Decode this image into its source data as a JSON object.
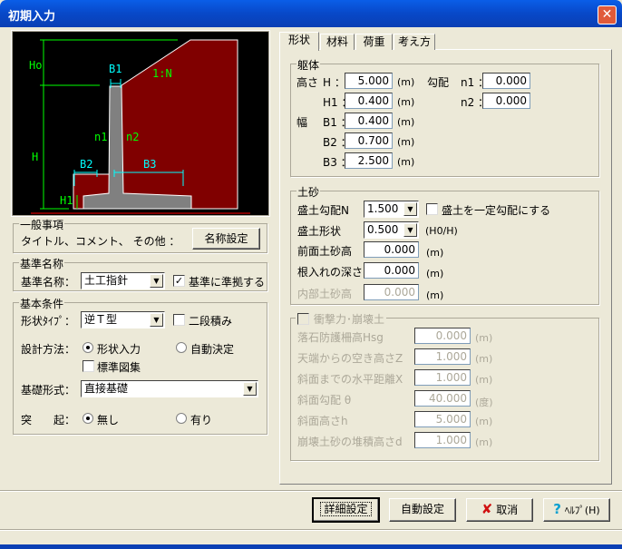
{
  "window": {
    "title": "初期入力",
    "close": "✕"
  },
  "diagram": {
    "labels": {
      "ho": "Ho",
      "h": "H",
      "h1": "H1",
      "b1": "B1",
      "b2": "B2",
      "b3": "B3",
      "n1": "n1",
      "n2": "n2",
      "slope": "1:N"
    }
  },
  "general": {
    "title": "一般事項",
    "text": "タイトル、コメント、 その他 ：",
    "button": "名称設定"
  },
  "standard": {
    "title": "基準名称",
    "label": "基準名称：",
    "value": "土工指針",
    "checkbox_label": "基準に準拠する",
    "checked": true
  },
  "basic": {
    "title": "基本条件",
    "shape_label": "形状ﾀｲﾌﾟ：",
    "shape_value": "逆Ｔ型",
    "two_stage": "二段積み",
    "design_label": "設計方法：",
    "design_opt1": "形状入力",
    "design_opt2": "自動決定",
    "std_drawings": "標準図集",
    "found_label": "基礎形式：",
    "found_value": "直接基礎",
    "proj_label": "突　　起：",
    "proj_opt1": "無し",
    "proj_opt2": "有り"
  },
  "tabs": [
    "形状",
    "材料",
    "荷重",
    "考え方"
  ],
  "body": {
    "title": "躯体",
    "height_label": "高さ",
    "width_label": "幅",
    "slope_label": "勾配",
    "unit": "(m)",
    "H": {
      "label": "H ：",
      "value": "5.000"
    },
    "H1": {
      "label": "H1 ：",
      "value": "0.400"
    },
    "B1": {
      "label": "B1 ：",
      "value": "0.400"
    },
    "B2": {
      "label": "B2 ：",
      "value": "0.700"
    },
    "B3": {
      "label": "B3 ：",
      "value": "2.500"
    },
    "n1": {
      "label": "n1 ：",
      "value": "0.000"
    },
    "n2": {
      "label": "n2 ：",
      "value": "0.000"
    }
  },
  "soil": {
    "title": "土砂",
    "fill_slope_label": "盛土勾配N",
    "fill_slope_value": "1.500",
    "const_slope": "盛土を一定勾配にする",
    "fill_shape_label": "盛土形状",
    "fill_shape_value": "0.500",
    "fill_shape_unit": "(H0/H)",
    "front_label": "前面土砂高",
    "front_value": "0.000",
    "embed_label": "根入れの深さ",
    "embed_value": "0.000",
    "inner_label": "内部土砂高",
    "inner_value": "0.000",
    "unit": "(m)"
  },
  "impact": {
    "title": "衝撃力･崩壊土",
    "rows": [
      {
        "label": "落石防護柵高Hsg",
        "value": "0.000",
        "unit": "(m)"
      },
      {
        "label": "天端からの空き高さZ",
        "value": "1.000",
        "unit": "(m)"
      },
      {
        "label": "斜面までの水平距離X",
        "value": "1.000",
        "unit": "(m)"
      },
      {
        "label": "斜面勾配 θ",
        "value": "40.000",
        "unit": "(度)"
      },
      {
        "label": "斜面高さh",
        "value": "5.000",
        "unit": "(m)"
      },
      {
        "label": "崩壊土砂の堆積高さd",
        "value": "1.000",
        "unit": "(m)"
      }
    ]
  },
  "buttons": {
    "detail": "詳細設定",
    "auto": "自動設定",
    "cancel": "取消",
    "help": "ﾍﾙﾌﾟ(H)"
  }
}
